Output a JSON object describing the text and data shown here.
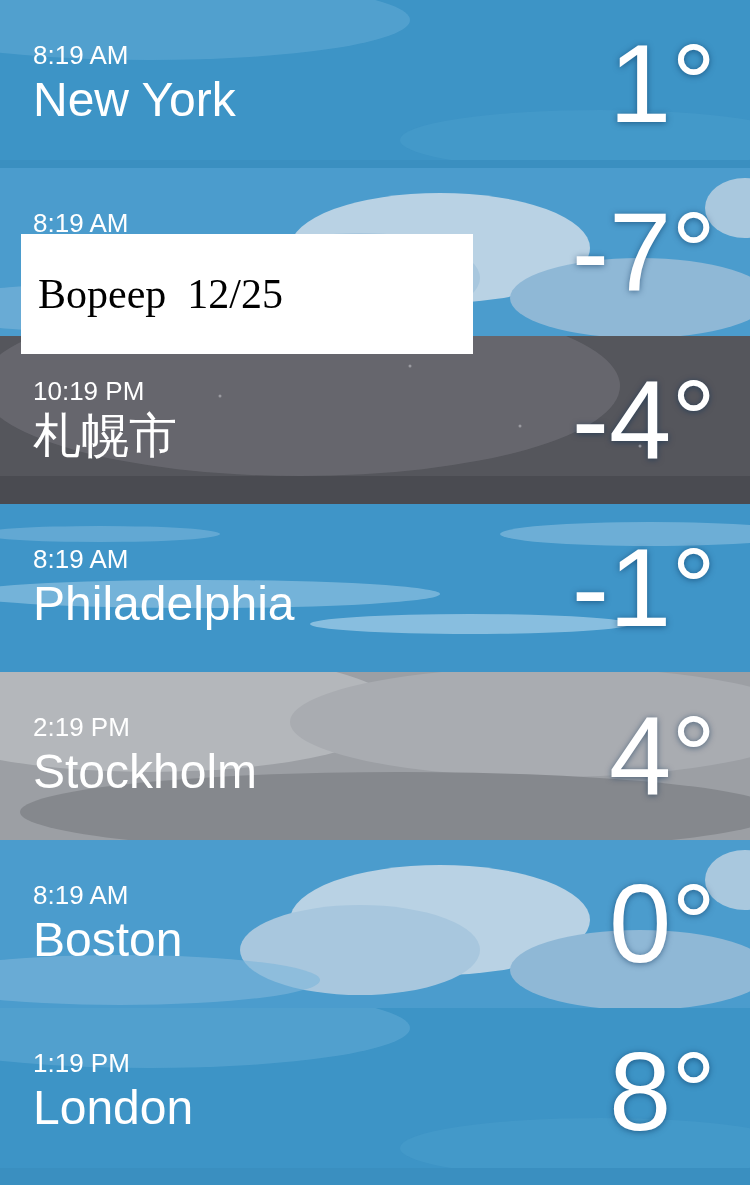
{
  "cities": [
    {
      "time": "8:19 AM",
      "name": "New York",
      "temperature": "1°",
      "kind": "clear"
    },
    {
      "time": "8:19 AM",
      "temperature": "-7°",
      "kind": "cloudy"
    },
    {
      "time": "10:19 PM",
      "name": "札幌市",
      "temperature": "-4°",
      "kind": "night"
    },
    {
      "time": "8:19 AM",
      "name": "Philadelphia",
      "temperature": "-1°",
      "kind": "wispy"
    },
    {
      "time": "2:19 PM",
      "name": "Stockholm",
      "temperature": "4°",
      "kind": "overcast"
    },
    {
      "time": "8:19 AM",
      "name": "Boston",
      "temperature": "0°",
      "kind": "cloudy"
    },
    {
      "time": "1:19 PM",
      "name": "London",
      "temperature": "8°",
      "kind": "clear"
    }
  ],
  "label": {
    "text": "Bopeep  12/25"
  }
}
